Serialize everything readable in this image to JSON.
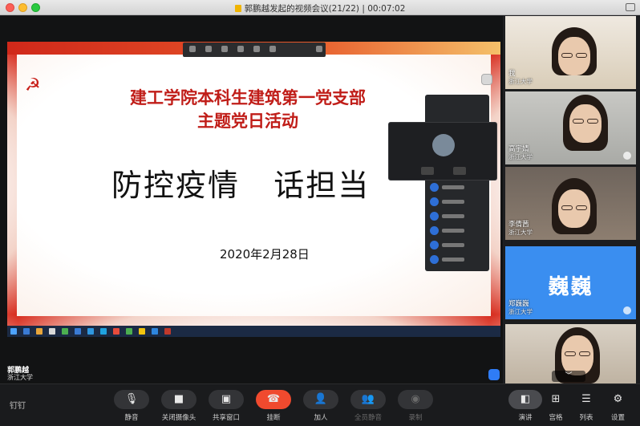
{
  "window": {
    "title": "郭鹏越发起的视频会议(21/22) | 00:07:02"
  },
  "slide": {
    "title_line1": "建工学院本科生建筑第一党支部",
    "title_line2": "主题党日活动",
    "headline": "防控疫情   话担当",
    "date": "2020年2月28日"
  },
  "speaker": {
    "name": "郭鹏越",
    "org": "浙江大学"
  },
  "participants": [
    {
      "name": "我",
      "org": "浙江大学"
    },
    {
      "name": "高宇婧",
      "org": "浙江大学"
    },
    {
      "name": "李倩茜",
      "org": "浙江大学"
    },
    {
      "name": "郑巍巍",
      "org": "浙江大学",
      "avatar_text": "巍巍"
    },
    {
      "name": "",
      "org": ""
    }
  ],
  "colors": {
    "accent_red": "#f04a2e",
    "avatar_blue": "#3a8ef0",
    "slide_red": "#c01d18"
  },
  "toolbar": {
    "logo": "钉钉",
    "buttons": [
      {
        "label": "静音",
        "icon": "microphone-icon"
      },
      {
        "label": "关闭摄像头",
        "icon": "camera-icon"
      },
      {
        "label": "共享窗口",
        "icon": "share-screen-icon"
      },
      {
        "label": "挂断",
        "icon": "hangup-icon"
      },
      {
        "label": "加人",
        "icon": "add-user-icon"
      },
      {
        "label": "全员静音",
        "icon": "mute-all-icon"
      },
      {
        "label": "录制",
        "icon": "record-icon"
      }
    ],
    "view_buttons": [
      {
        "label": "演讲",
        "icon": "speaker-view-icon"
      },
      {
        "label": "宫格",
        "icon": "grid-view-icon"
      },
      {
        "label": "列表",
        "icon": "list-view-icon"
      },
      {
        "label": "设置",
        "icon": "gear-icon"
      }
    ]
  }
}
